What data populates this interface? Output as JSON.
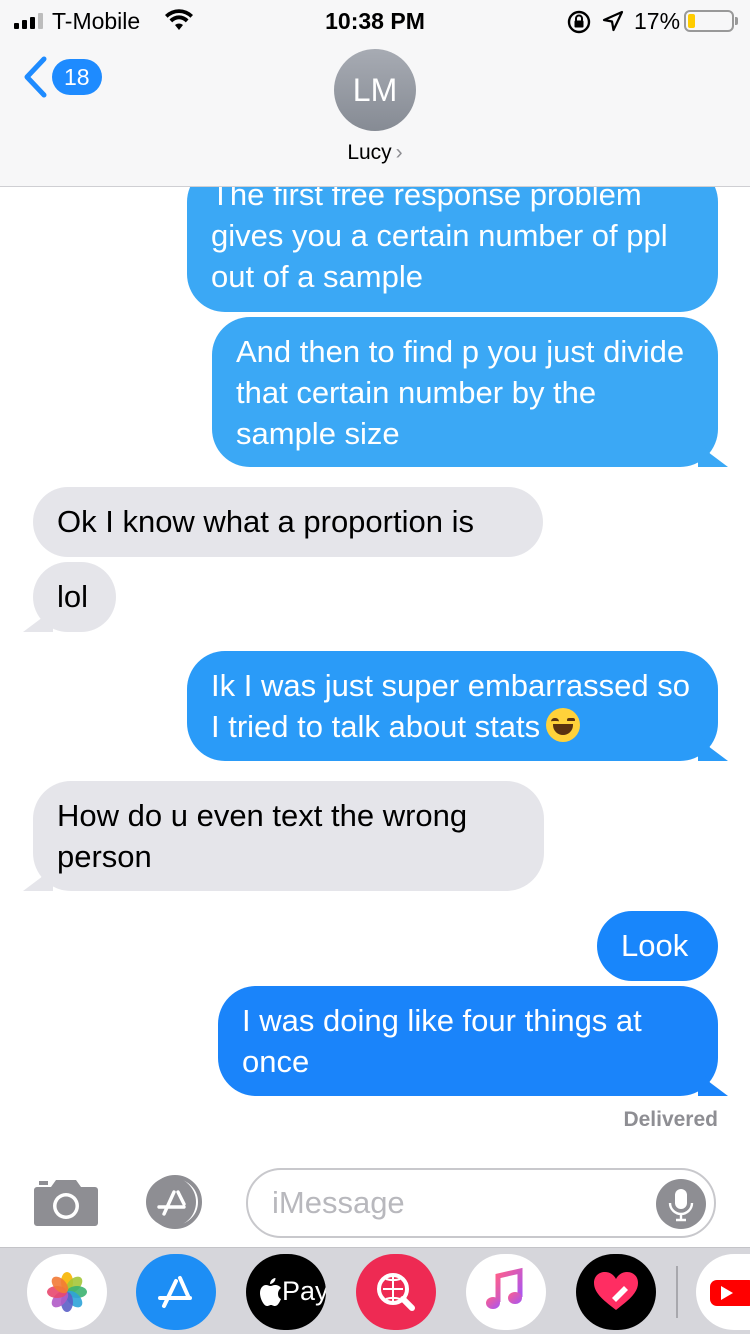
{
  "status_bar": {
    "carrier": "T-Mobile",
    "time": "10:38 PM",
    "battery_percent": "17%",
    "battery_level": 0.17,
    "icons": [
      "signal-icon",
      "wifi-icon",
      "orientation-lock-icon",
      "location-icon",
      "battery-icon"
    ]
  },
  "nav": {
    "back_count": "18",
    "avatar_initials": "LM",
    "contact_name": "Lucy",
    "chevron": "›"
  },
  "messages": [
    {
      "side": "sent",
      "text": "The first free response problem gives you a certain number of ppl out of a sample"
    },
    {
      "side": "sent",
      "text": "And then to find p you just divide that certain number by the sample size"
    },
    {
      "side": "received",
      "text": "Ok I know what a proportion is"
    },
    {
      "side": "received",
      "text": "lol"
    },
    {
      "side": "sent",
      "text": "Ik I was just super embarrassed so I tried to talk about stats",
      "emoji": "face-with-tears-of-joy"
    },
    {
      "side": "received",
      "text": "How do u even text the wrong person"
    },
    {
      "side": "sent",
      "text": "Look"
    },
    {
      "side": "sent",
      "text": "I was doing like four things at once"
    }
  ],
  "delivered_label": "Delivered",
  "input": {
    "placeholder": "iMessage"
  },
  "app_drawer": {
    "apps": [
      "photos-app-icon",
      "app-store-app-icon",
      "apple-pay-app-icon",
      "search-images-app-icon",
      "music-app-icon",
      "digital-touch-app-icon",
      "youtube-app-icon"
    ],
    "apple_pay_label": "Pay"
  },
  "colors": {
    "sent_blue": "#1e8dff",
    "sent_blue_light": "#3ba8f5",
    "received_gray": "#e5e5ea",
    "header_bg": "#f7f7f8",
    "back_badge": "#1e8bff"
  }
}
